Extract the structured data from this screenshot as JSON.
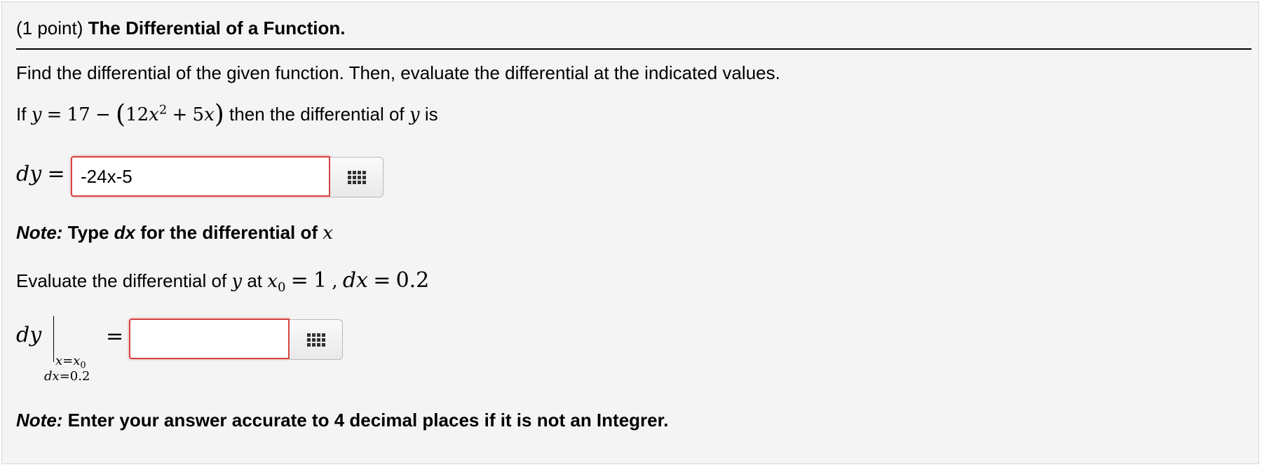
{
  "problem": {
    "points": "(1 point)",
    "title": "The Differential of a Function."
  },
  "instructions": "Find the differential of the given function. Then, evaluate the differential at the indicated values.",
  "statement": {
    "prefix": "If",
    "y": "y",
    "eq": "=",
    "c17": "17",
    "minus": "−",
    "lparen": "(",
    "c12": "12",
    "x1": "x",
    "pow": "2",
    "plus": "+",
    "c5": "5",
    "x2": "x",
    "rparen": ")",
    "suffix": "then the differential of",
    "yvar": "y",
    "is": "is"
  },
  "dy_label": {
    "d": "dy",
    "eq": "="
  },
  "answer1": {
    "value": "-24x-5",
    "placeholder": ""
  },
  "note1": {
    "lead": "Note:",
    "text1": "Type",
    "dx": "dx",
    "text2": "for the differential of",
    "x": "x"
  },
  "evaluate": {
    "text": "Evaluate the differential of",
    "y": "y",
    "at": "at",
    "x0": "x",
    "sub0": "0",
    "eq1": "=",
    "one": "1",
    "comma": ",",
    "dx": "dx",
    "eq2": "=",
    "val": "0.2"
  },
  "dy_eval": {
    "d": "dy",
    "cond1_x": "x",
    "cond1_eq": "=",
    "cond1_x0": "x",
    "cond1_sub": "0",
    "cond2": "dx",
    "cond2_eq": "=",
    "cond2_val": "0.2",
    "eq": "="
  },
  "answer2": {
    "value": "",
    "placeholder": ""
  },
  "note2": {
    "lead": "Note:",
    "text": "Enter your answer accurate to 4 decimal places if it is not an Integrer."
  },
  "icons": {
    "keyboard": "equation-editor-grid-icon"
  },
  "colors": {
    "invalid_border": "#d64545",
    "panel_bg": "#f4f4f4"
  }
}
